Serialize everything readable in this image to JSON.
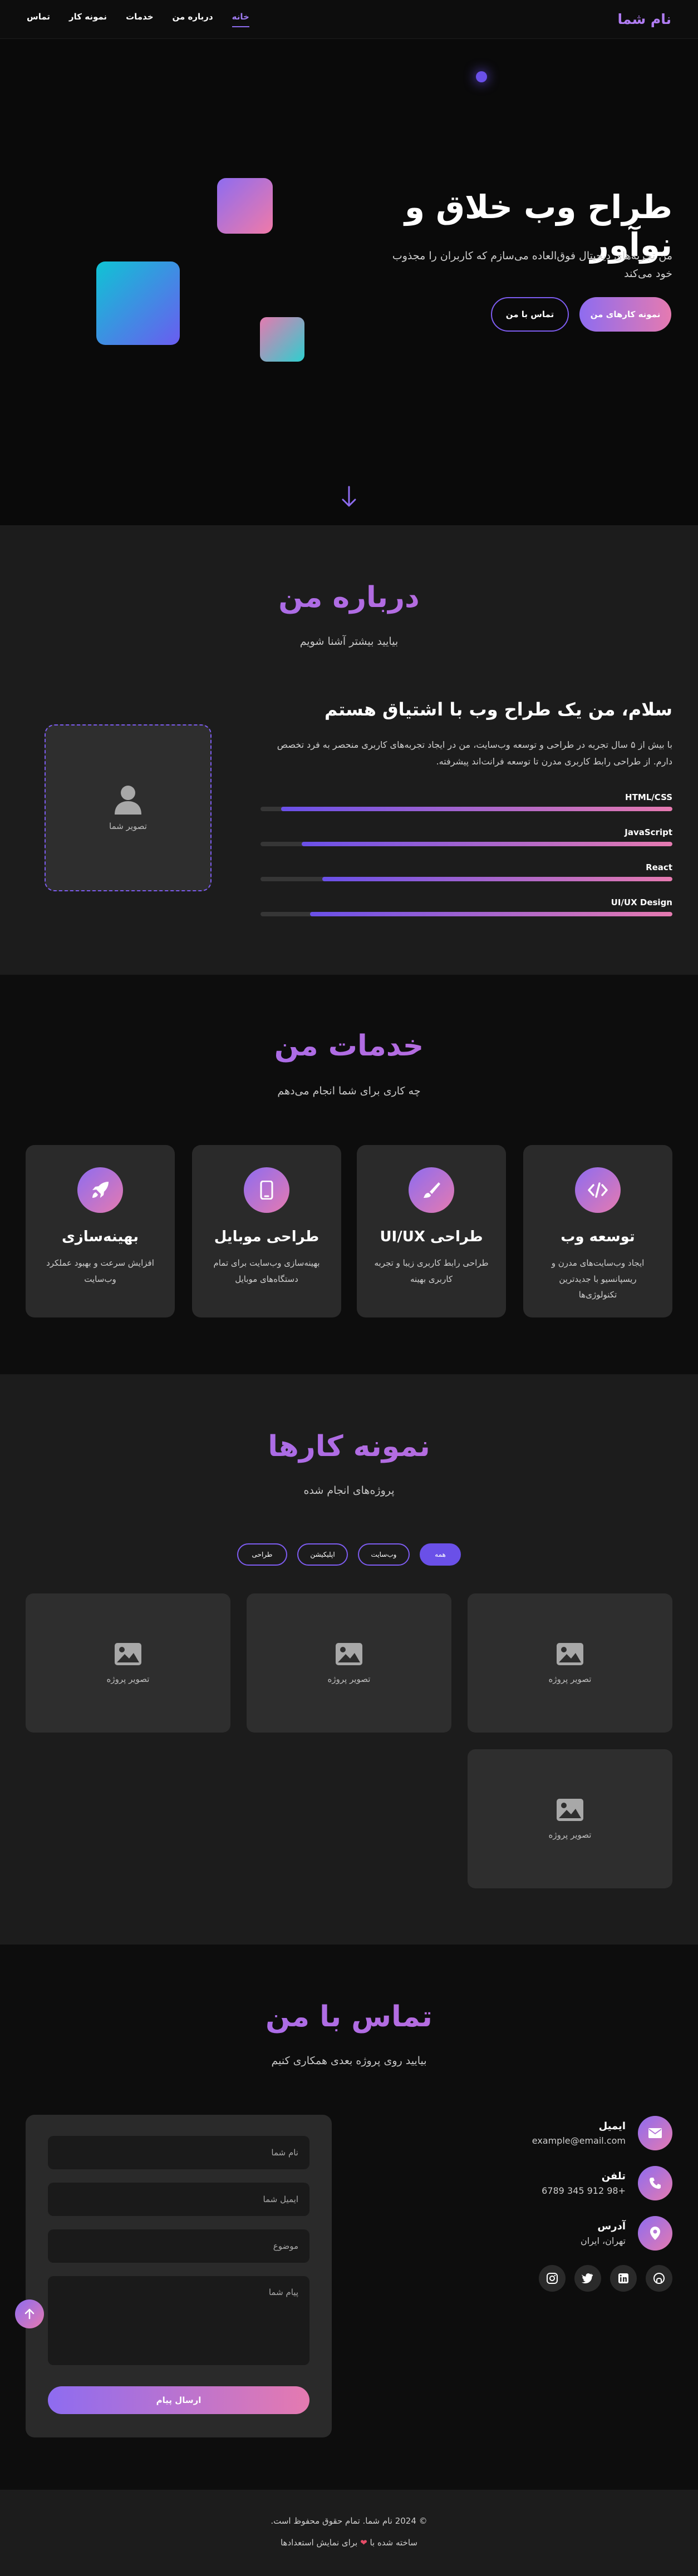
{
  "nav": {
    "brand": "نام شما",
    "links": [
      "خانه",
      "درباره من",
      "خدمات",
      "نمونه کار",
      "تماس"
    ]
  },
  "hero": {
    "title": "طراح وب خلاق و نوآور",
    "subtitle": "من تجربه‌های دیجیتال فوق‌العاده می‌سازم که کاربران را مجذوب خود می‌کند",
    "primary_button": "نمونه کارهای من",
    "secondary_button": "تماس با من"
  },
  "about": {
    "title": "درباره من",
    "subtitle": "بیایید بیشتر آشنا شویم",
    "heading": "سلام، من یک طراح وب با اشتیاق هستم",
    "description": "با بیش از ۵ سال تجربه در طراحی و توسعه وب‌سایت، من در ایجاد تجربه‌های کاربری منحصر به فرد تخصص دارم. از طراحی رابط کاربری مدرن تا توسعه فرانت‌اند پیشرفته.",
    "photo_label": "تصویر شما",
    "skills": [
      {
        "name": "HTML/CSS",
        "level": 0.95
      },
      {
        "name": "JavaScript",
        "level": 0.9
      },
      {
        "name": "React",
        "level": 0.85
      },
      {
        "name": "UI/UX Design",
        "level": 0.88
      }
    ]
  },
  "services": {
    "title": "خدمات من",
    "subtitle": "چه کاری برای شما انجام می‌دهم",
    "items": [
      {
        "title": "توسعه وب",
        "desc": "ایجاد وب‌سایت‌های مدرن و ریسپانسیو با جدیدترین تکنولوژی‌ها",
        "icon": "code-icon"
      },
      {
        "title": "طراحی UI/UX",
        "desc": "طراحی رابط کاربری زیبا و تجربه کاربری بهینه",
        "icon": "paint-brush-icon"
      },
      {
        "title": "طراحی موبایل",
        "desc": "بهینه‌سازی وب‌سایت برای تمام دستگاه‌های موبایل",
        "icon": "mobile-icon"
      },
      {
        "title": "بهینه‌سازی",
        "desc": "افزایش سرعت و بهبود عملکرد وب‌سایت",
        "icon": "rocket-icon"
      }
    ]
  },
  "portfolio": {
    "title": "نمونه کارها",
    "subtitle": "پروژه‌های انجام شده",
    "filters": [
      "همه",
      "وب‌سایت",
      "اپلیکیشن",
      "طراحی"
    ],
    "project_label": "تصویر پروژه"
  },
  "contact": {
    "title": "تماس با من",
    "subtitle": "بیایید روی پروژه بعدی همکاری کنیم",
    "info": [
      {
        "title": "ایمیل",
        "value": "example@email.com",
        "icon": "envelope-icon"
      },
      {
        "title": "تلفن",
        "value": "+98 912 345 6789",
        "icon": "phone-icon"
      },
      {
        "title": "آدرس",
        "value": "تهران، ایران",
        "icon": "location-icon"
      }
    ],
    "socials": [
      "github-icon",
      "linkedin-icon",
      "twitter-icon",
      "instagram-icon"
    ],
    "form": {
      "name_placeholder": "نام شما",
      "email_placeholder": "ایمیل شما",
      "subject_placeholder": "موضوع",
      "message_placeholder": "پیام شما",
      "submit": "ارسال پیام"
    }
  },
  "footer": {
    "copyright": "© 2024 نام شما. تمام حقوق محفوظ است.",
    "made_prefix": "ساخته شده با",
    "made_suffix": "برای نمایش استعدادها"
  },
  "colors": {
    "accent": "#8e6cf0",
    "accent_pink": "#e57ab0",
    "background": "#0a0a0a",
    "surface": "#1c1c1c"
  }
}
